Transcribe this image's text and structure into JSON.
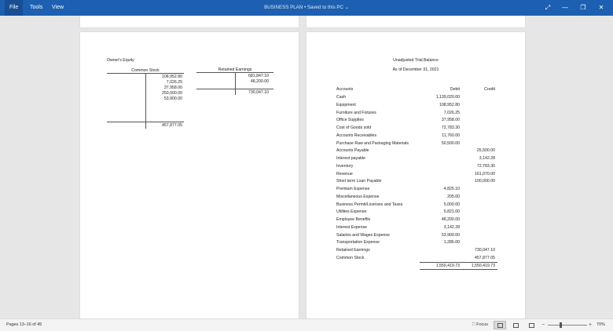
{
  "menu": {
    "file": "File",
    "tools": "Tools",
    "view": "View"
  },
  "title": {
    "name": "BUSINESS PLAN",
    "status": "• Saved to this PC",
    "dropdown_glyph": "⌄"
  },
  "window_icons": {
    "focus": "⤢",
    "minimize": "—",
    "restore": "❐",
    "close": "✕"
  },
  "owners_equity": {
    "title": "Owner's Equity",
    "common_stock": {
      "header": "Common Stock",
      "entries": [
        "108,952.80",
        "7,026.25",
        "37,958.00",
        "250,000.00",
        "53,900.00"
      ],
      "total": "457,877.05"
    },
    "retained_earnings": {
      "header": "Retained Earnings",
      "entries": [
        "681,847.10",
        "48,200.00"
      ],
      "total": "730,047.10"
    }
  },
  "trial_balance": {
    "title": "Unadjusted Trial Balance",
    "date": "As of December 31, 2021",
    "headers": {
      "account": "Accounts",
      "debit": "Debit",
      "credit": "Credit"
    },
    "rows": [
      {
        "account": "Cash",
        "debit": "1,139,020.00",
        "credit": ""
      },
      {
        "account": "Equipment",
        "debit": "108,952.80",
        "credit": ""
      },
      {
        "account": "Furniture and Fixtures",
        "debit": "7,026.25",
        "credit": ""
      },
      {
        "account": "Office Supplies",
        "debit": "37,958.00",
        "credit": ""
      },
      {
        "account": "Cost of Goods sold",
        "debit": "72,783.30",
        "credit": ""
      },
      {
        "account": "Accounts Receivables",
        "debit": "11,760.00",
        "credit": ""
      },
      {
        "account": "Purchase Raw and Packaging Materials",
        "debit": "50,500.00",
        "credit": ""
      },
      {
        "account": "Accounts Payable",
        "debit": "",
        "credit": "25,500.00"
      },
      {
        "account": "Interest payable",
        "debit": "",
        "credit": "3,142.28"
      },
      {
        "account": "Inventory",
        "debit": "",
        "credit": "72,783.30"
      },
      {
        "account": "Revenue",
        "debit": "",
        "credit": "161,070.00"
      },
      {
        "account": "Short term Loan Payable",
        "debit": "",
        "credit": "100,000.00"
      },
      {
        "account": "Premium Expense",
        "debit": "4,825.10",
        "credit": ""
      },
      {
        "account": "Miscellaneous Expense",
        "debit": "205.00",
        "credit": ""
      },
      {
        "account": "Business Permit/Licenses and Taxes",
        "debit": "5,000.00",
        "credit": ""
      },
      {
        "account": "Utilities Expense",
        "debit": "5,821.00",
        "credit": ""
      },
      {
        "account": "Employee Benefits",
        "debit": "48,200.00",
        "credit": ""
      },
      {
        "account": "Interest Expense",
        "debit": "3,142.28",
        "credit": ""
      },
      {
        "account": "Salaries and Wages Expense",
        "debit": "53,900.00",
        "credit": ""
      },
      {
        "account": "Transportation Expense",
        "debit": "1,286.00",
        "credit": ""
      },
      {
        "account": "Retained Earnings",
        "debit": "",
        "credit": "730,047.10"
      },
      {
        "account": "Common Stock",
        "debit": "",
        "credit": "457,877.05"
      }
    ],
    "totals": {
      "debit": "1,550,419.73",
      "credit": "1,550,419.73"
    }
  },
  "status": {
    "pages": "Pages 13–16 of 45",
    "focus": "Focus",
    "zoom": "70%",
    "zoom_minus": "−",
    "zoom_plus": "+",
    "zoom_value": 0.33
  }
}
